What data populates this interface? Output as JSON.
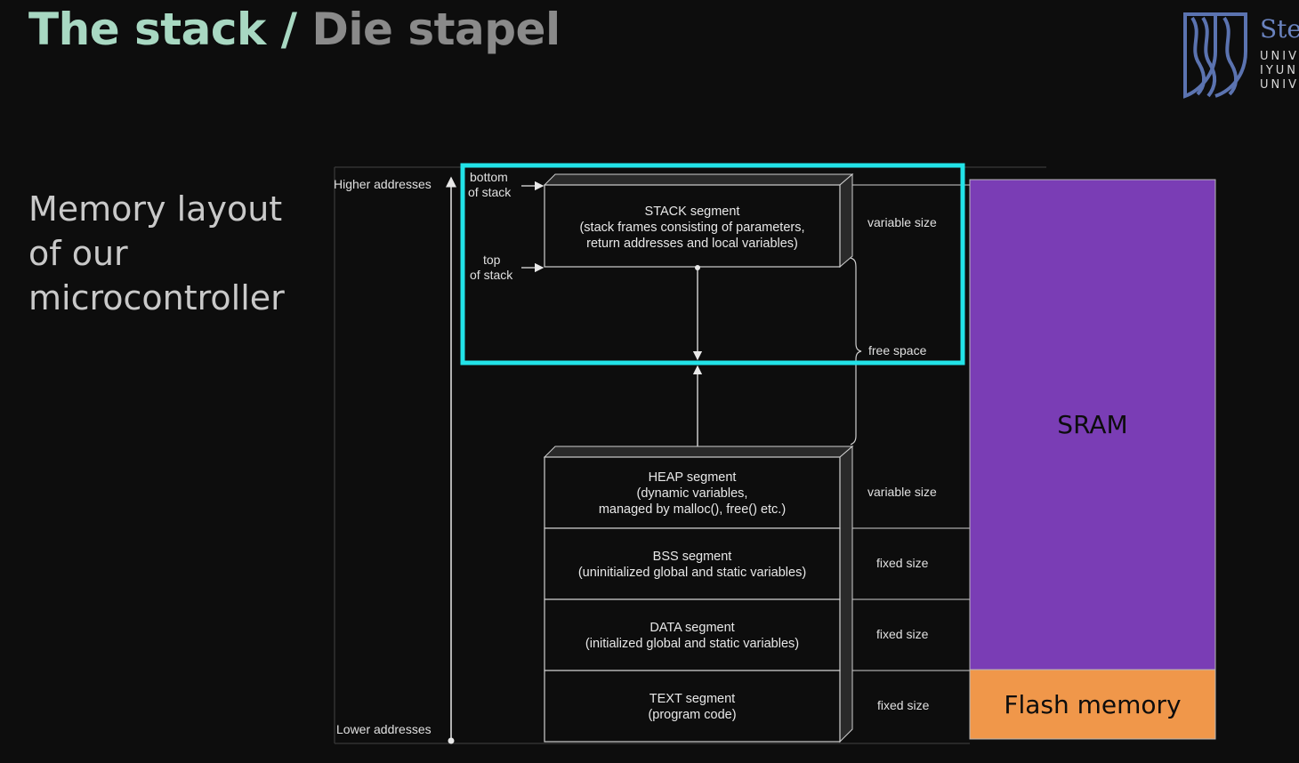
{
  "slide": {
    "title_main": "The stack / ",
    "title_alt": "Die stapel",
    "subtitle": "Memory layout of our microcontroller"
  },
  "logo": {
    "icon": "stellenbosch-crest-icon",
    "word": "Ste",
    "line1": "UNIV",
    "line2": "IYUN",
    "line3": "UNIV"
  },
  "diagram": {
    "higher_addresses": "Higher addresses",
    "lower_addresses": "Lower addresses",
    "bottom_of_stack": [
      "bottom",
      "of stack"
    ],
    "top_of_stack": [
      "top",
      "of stack"
    ],
    "free_space": "free space",
    "segments": {
      "stack": [
        "STACK segment",
        "(stack frames consisting of parameters,",
        "return addresses and local variables)"
      ],
      "heap": [
        "HEAP segment",
        "(dynamic variables,",
        "managed by malloc(), free() etc.)"
      ],
      "bss": [
        "BSS segment",
        "(uninitialized global and static variables)"
      ],
      "data": [
        "DATA segment",
        "(initialized global and static variables)"
      ],
      "text": [
        "TEXT segment",
        "(program code)"
      ]
    },
    "sizes": {
      "stack": "variable size",
      "heap": "variable size",
      "bss": "fixed size",
      "data": "fixed size",
      "text": "fixed size"
    }
  },
  "memory_blocks": {
    "sram": "SRAM",
    "flash": "Flash memory",
    "sram_color": "#7a3db5",
    "flash_color": "#f0974a",
    "highlight_color": "#22e3e8"
  }
}
